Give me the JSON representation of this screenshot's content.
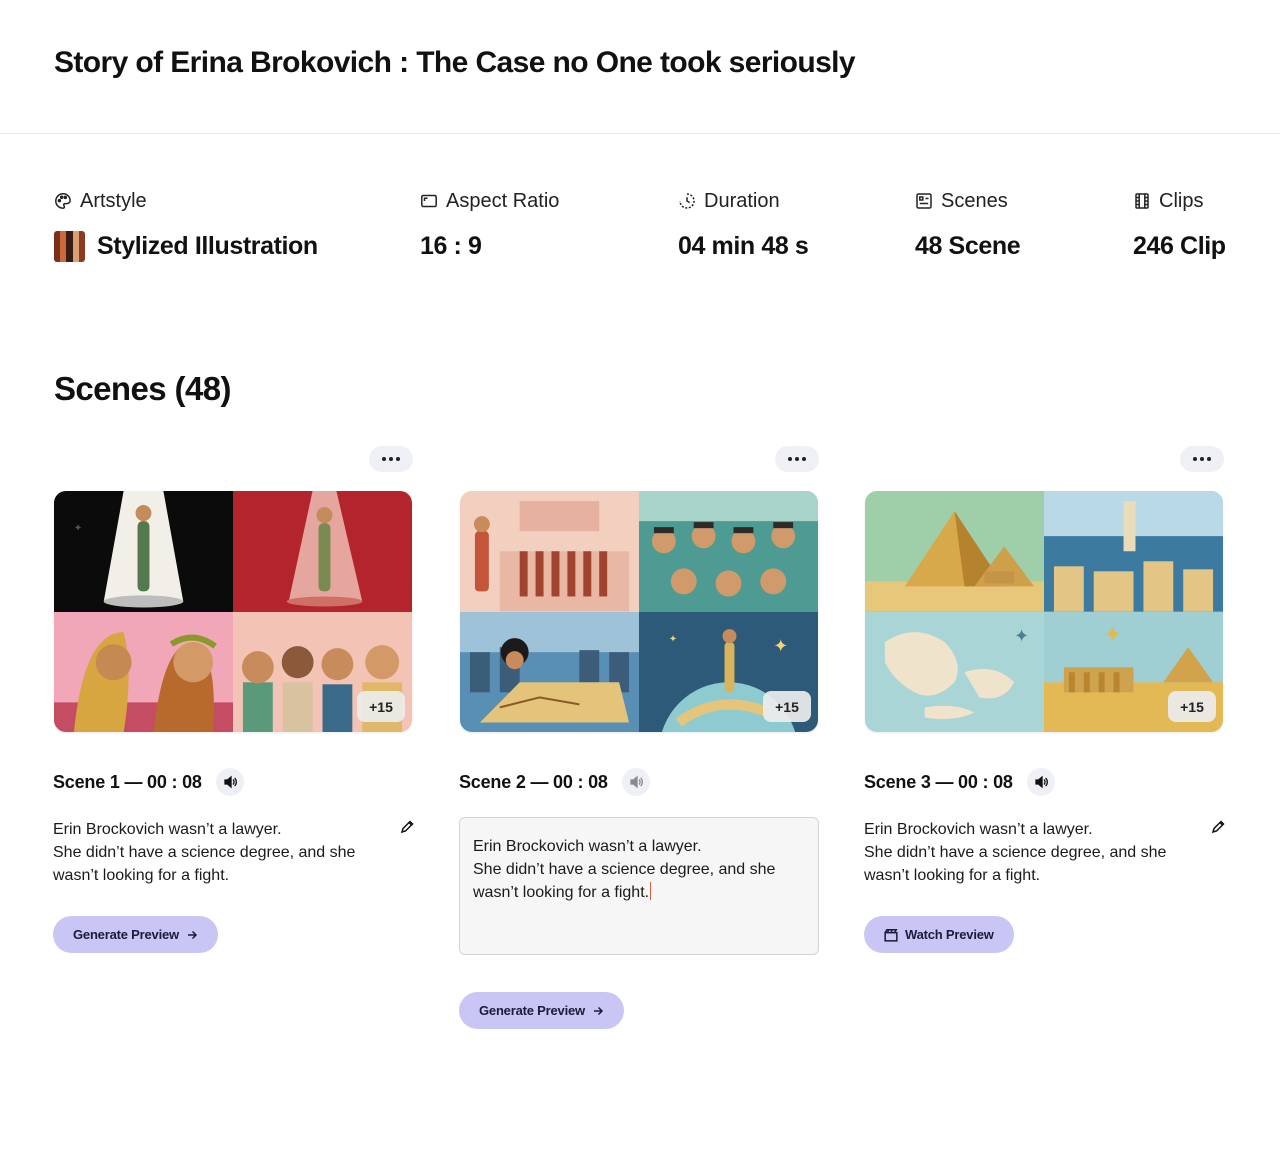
{
  "page": {
    "title": "Story of Erina Brokovich : The Case no One took seriously"
  },
  "stats": [
    {
      "label": "Artstyle",
      "value": "Stylized Illustration",
      "icon": "palette-icon"
    },
    {
      "label": "Aspect Ratio",
      "value": "16 : 9",
      "icon": "aspect-ratio-icon"
    },
    {
      "label": "Duration",
      "value": "04 min 48 s",
      "icon": "clock-icon"
    },
    {
      "label": "Scenes",
      "value": "48 Scene",
      "icon": "scenes-icon"
    },
    {
      "label": "Clips",
      "value": "246 Clip",
      "icon": "film-icon"
    }
  ],
  "section": {
    "title": "Scenes (48)"
  },
  "scenes": [
    {
      "title": "Scene 1 — 00 : 08",
      "extra_count": "+15",
      "description_lines": [
        "Erin Brockovich wasn’t a lawyer.",
        "She didn’t have a science degree, and she",
        "wasn’t looking for a fight."
      ],
      "action_label": "Generate Preview",
      "audio_state": "on",
      "editing": false
    },
    {
      "title": "Scene 2 — 00 : 08",
      "extra_count": "+15",
      "description_lines": [
        "Erin Brockovich wasn’t a lawyer.",
        "She didn’t have a science degree, and she",
        "wasn’t looking for a fight."
      ],
      "action_label": "Generate Preview",
      "audio_state": "muted",
      "editing": true
    },
    {
      "title": "Scene 3 — 00 : 08",
      "extra_count": "+15",
      "description_lines": [
        "Erin Brockovich wasn’t a lawyer.",
        "She didn’t have a science degree, and she",
        "wasn’t looking for a fight."
      ],
      "action_label": "Watch Preview",
      "audio_state": "on",
      "editing": false
    }
  ],
  "colors": {
    "accent": "#c9c6f6",
    "chip_bg": "#eef0f5",
    "caret": "#e05a3b",
    "divider": "#ececec"
  }
}
